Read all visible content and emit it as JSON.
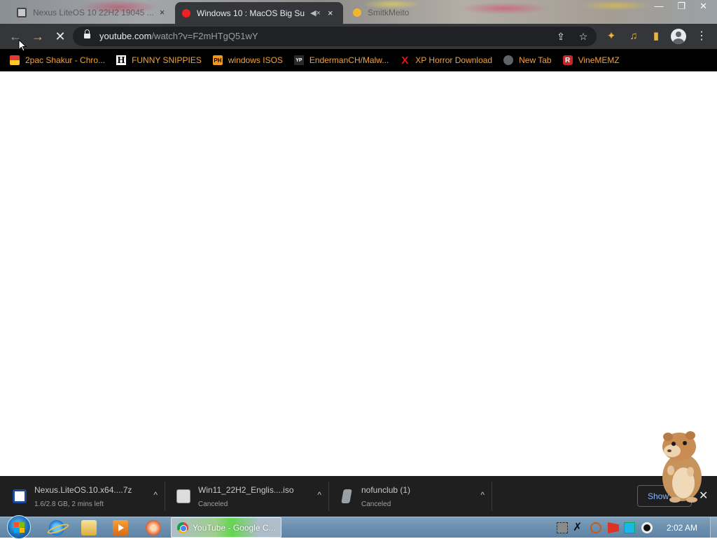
{
  "tabs": [
    {
      "label": "Nexus LiteOS 10 22H2 19045 ...",
      "close": "×"
    },
    {
      "label": "Windows 10 : MacOS Big Su",
      "close": "×",
      "mute": "◀×"
    },
    {
      "label": "SmitkMeito",
      "close": ""
    }
  ],
  "window_controls": {
    "minimize": "—",
    "maximize": "❐",
    "close": "✕"
  },
  "toolbar": {
    "back": "←",
    "forward": "→",
    "stop": "✕",
    "url_host": "youtube.com",
    "url_path": "/watch?v=F2mHTgQ51wY",
    "share": "⇪",
    "star": "☆",
    "extensions": "✦",
    "media": "♫",
    "sidepanel": "▮",
    "menu": "⋮"
  },
  "bookmarks": [
    {
      "label": "2pac Shakur - Chro...",
      "icon": "tv-icon"
    },
    {
      "label": "FUNNY SNIPPIES",
      "icon": "h-icon",
      "glyph": "H"
    },
    {
      "label": "windows ISOS",
      "icon": "ph-icon",
      "glyph": "PH"
    },
    {
      "label": "EndermanCH/Malw...",
      "icon": "yp-icon",
      "glyph": "YP"
    },
    {
      "label": "XP Horror Download",
      "icon": "x-icon",
      "glyph": "X"
    },
    {
      "label": "New Tab",
      "icon": "globe-icon"
    },
    {
      "label": "VineMEMZ",
      "icon": "r-icon",
      "glyph": "R"
    }
  ],
  "downloads": [
    {
      "name": "Nexus.LiteOS.10.x64....7z",
      "status": "1.6/2.8 GB, 2 mins left",
      "chevron": "^"
    },
    {
      "name": "Win11_22H2_Englis....iso",
      "status": "Canceled",
      "chevron": "^"
    },
    {
      "name": "nofunclub (1)",
      "status": "Canceled",
      "chevron": "^"
    }
  ],
  "download_bar": {
    "show_all": "Show all",
    "close": "✕"
  },
  "taskbar": {
    "chrome_label": "YouTube - Google C...",
    "clock": "2:02 AM",
    "tray_x": "✗"
  }
}
